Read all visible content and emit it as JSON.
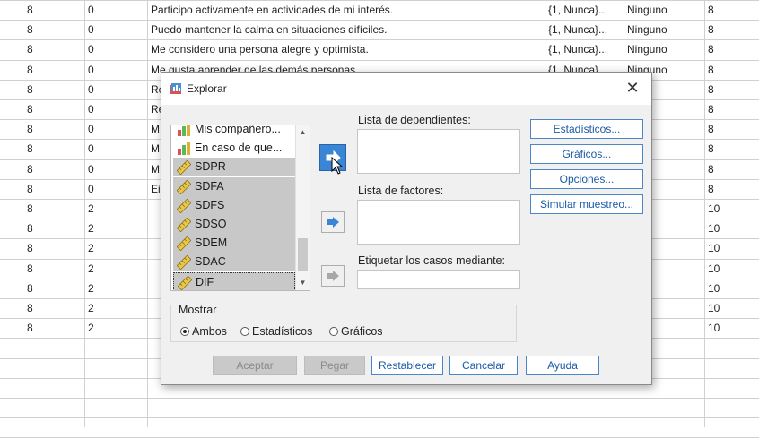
{
  "grid": {
    "rows": [
      {
        "c1": "8",
        "c2": "0",
        "c3": "Participo activamente en actividades de mi interés.",
        "c4": "{1, Nunca}...",
        "c5": "Ninguno",
        "c6": "8"
      },
      {
        "c1": "8",
        "c2": "0",
        "c3": "Puedo mantener la calma en situaciones difíciles.",
        "c4": "{1, Nunca}...",
        "c5": "Ninguno",
        "c6": "8"
      },
      {
        "c1": "8",
        "c2": "0",
        "c3": "Me considero una persona alegre y optimista.",
        "c4": "{1, Nunca}...",
        "c5": "Ninguno",
        "c6": "8"
      },
      {
        "c1": "8",
        "c2": "0",
        "c3": "Me gusta aprender de las demás personas.",
        "c4": "{1, Nunca}",
        "c5": "Ninguno",
        "c6": "8"
      },
      {
        "c1": "8",
        "c2": "0",
        "c3": "Re",
        "c4": "",
        "c5": "uno",
        "c6": "8"
      },
      {
        "c1": "8",
        "c2": "0",
        "c3": "Re",
        "c4": "",
        "c5": "uno",
        "c6": "8"
      },
      {
        "c1": "8",
        "c2": "0",
        "c3": "M",
        "c4": "",
        "c5": "uno",
        "c6": "8"
      },
      {
        "c1": "8",
        "c2": "0",
        "c3": "M",
        "c4": "",
        "c5": "uno",
        "c6": "8"
      },
      {
        "c1": "8",
        "c2": "0",
        "c3": "M",
        "c4": "",
        "c5": "uno",
        "c6": "8"
      },
      {
        "c1": "8",
        "c2": "0",
        "c3": "Ei",
        "c4": "",
        "c5": "uno",
        "c6": "8"
      },
      {
        "c1": "8",
        "c2": "2",
        "c3": "",
        "c4": "",
        "c5": "uno",
        "c6": "10"
      },
      {
        "c1": "8",
        "c2": "2",
        "c3": "",
        "c4": "",
        "c5": "uno",
        "c6": "10"
      },
      {
        "c1": "8",
        "c2": "2",
        "c3": "",
        "c4": "",
        "c5": "uno",
        "c6": "10"
      },
      {
        "c1": "8",
        "c2": "2",
        "c3": "",
        "c4": "",
        "c5": "uno",
        "c6": "10"
      },
      {
        "c1": "8",
        "c2": "2",
        "c3": "",
        "c4": "",
        "c5": "uno",
        "c6": "10"
      },
      {
        "c1": "8",
        "c2": "2",
        "c3": "",
        "c4": "",
        "c5": "uno",
        "c6": "10"
      },
      {
        "c1": "8",
        "c2": "2",
        "c3": "",
        "c4": "",
        "c5": "uno",
        "c6": "10"
      }
    ]
  },
  "dialog": {
    "title": "Explorar",
    "close_glyph": "✕",
    "variables": [
      {
        "label": "Mis compañero...",
        "icon": "nominal-icon"
      },
      {
        "label": "En caso de que...",
        "icon": "nominal-icon"
      },
      {
        "label": "SDPR",
        "icon": "scale-ruler-icon"
      },
      {
        "label": "SDFA",
        "icon": "scale-ruler-icon"
      },
      {
        "label": "SDFS",
        "icon": "scale-ruler-icon"
      },
      {
        "label": "SDSO",
        "icon": "scale-ruler-icon"
      },
      {
        "label": "SDEM",
        "icon": "scale-ruler-icon"
      },
      {
        "label": "SDAC",
        "icon": "scale-ruler-icon"
      },
      {
        "label": "DIF",
        "icon": "scale-ruler-icon"
      }
    ],
    "dependents_label": "Lista de dependientes:",
    "factors_label": "Lista de factores:",
    "label_cases_label": "Etiquetar los casos mediante:",
    "side_buttons": {
      "statistics": "Estadísticos...",
      "plots": "Gráficos...",
      "options": "Opciones...",
      "bootstrap": "Simular muestreo..."
    },
    "display": {
      "title": "Mostrar",
      "both": "Ambos",
      "statistics": "Estadísticos",
      "plots": "Gráficos",
      "selected": "both"
    },
    "bottom_buttons": {
      "ok": "Aceptar",
      "paste": "Pegar",
      "reset": "Restablecer",
      "cancel": "Cancelar",
      "help": "Ayuda"
    }
  },
  "colors": {
    "accent_blue": "#3a86d4",
    "button_text": "#1b5aa6",
    "selected_item": "#c8c8c8"
  }
}
